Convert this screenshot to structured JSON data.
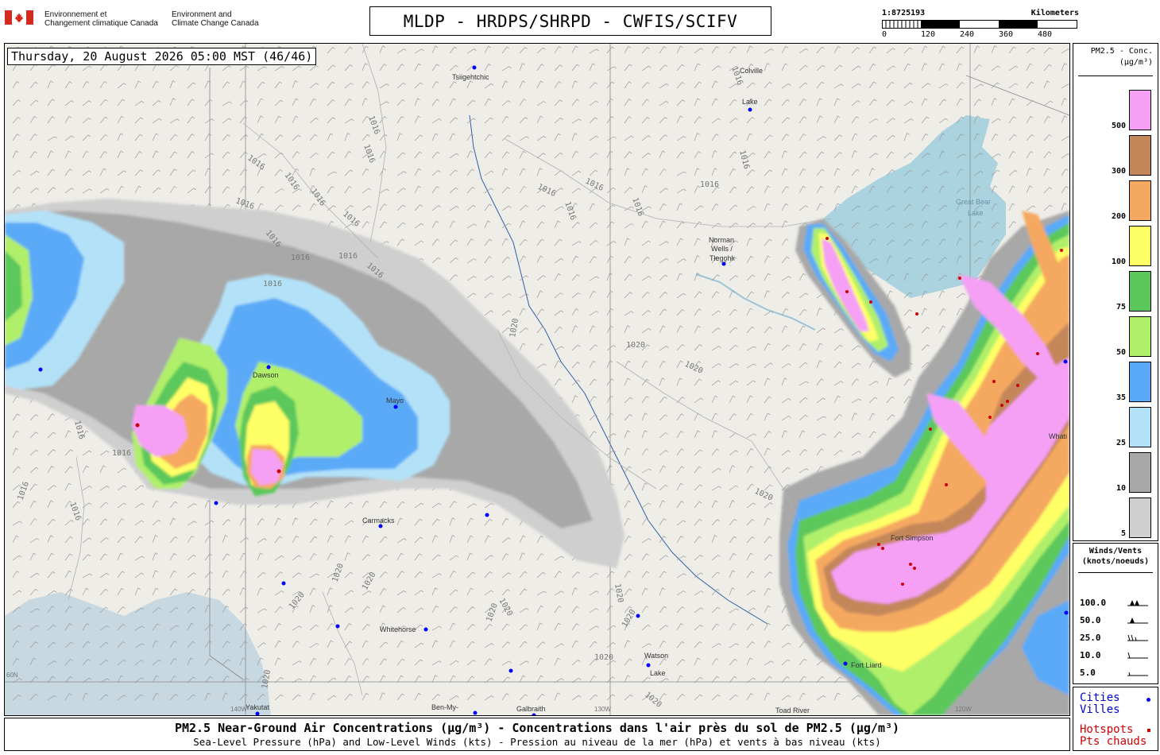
{
  "agency": {
    "name_fr": [
      "Environnement et",
      "Changement climatique Canada"
    ],
    "name_en": [
      "Environment and",
      "Climate Change Canada"
    ]
  },
  "title": "MLDP - HRDPS/SHRPD - CWFIS/SCIFV",
  "scale": {
    "ratio": "1:8725193",
    "unit": "Kilometers",
    "ticks": [
      "0",
      "120",
      "240",
      "360",
      "480"
    ]
  },
  "timestamp": "Thursday, 20 August 2026 05:00 MST (46/46)",
  "map": {
    "places": [
      {
        "name": "Tsiigehtchic"
      },
      {
        "name": "Colville"
      },
      {
        "name": "Lake"
      },
      {
        "name": "Great Bear"
      },
      {
        "name": "Lake"
      },
      {
        "name": "Norman"
      },
      {
        "name": "Wells /"
      },
      {
        "name": "Tłegǫhłı"
      },
      {
        "name": "Dawson"
      },
      {
        "name": "Carmacks"
      },
      {
        "name": "Whitehorse"
      },
      {
        "name": "Watson"
      },
      {
        "name": "Lake"
      },
      {
        "name": "Fort Simpson"
      },
      {
        "name": "Fort Liard"
      },
      {
        "name": "Yakutat"
      },
      {
        "name": "Ben-My-"
      },
      {
        "name": "Galbraith"
      },
      {
        "name": "Toad River"
      },
      {
        "name": "Whati"
      },
      {
        "name": "Mayo"
      }
    ],
    "graticule_labels": [
      "130W",
      "120W",
      "60N",
      "140W"
    ],
    "isobar_labels": [
      "1016",
      "1016",
      "1016",
      "1016",
      "1016",
      "1016",
      "1016",
      "1016",
      "1016",
      "1016",
      "1016",
      "1016",
      "1016",
      "1016",
      "1016",
      "1016",
      "1016",
      "1016",
      "1016",
      "1016",
      "1016",
      "1016",
      "1016",
      "1020",
      "1020",
      "1020",
      "1020",
      "1020",
      "1020",
      "1020",
      "1020",
      "1020",
      "1020",
      "1020",
      "1020",
      "1020",
      "1020"
    ]
  },
  "legend": {
    "title_lines": [
      "PM2.5 - Conc.",
      "(µg/m³)"
    ],
    "bins": [
      {
        "label": "500",
        "color": "#f5a0f5"
      },
      {
        "label": "300",
        "color": "#c4875a"
      },
      {
        "label": "200",
        "color": "#f5a860"
      },
      {
        "label": "100",
        "color": "#ffff66"
      },
      {
        "label": "75",
        "color": "#5cc85c"
      },
      {
        "label": "50",
        "color": "#b0ef6a"
      },
      {
        "label": "35",
        "color": "#5aaaf8"
      },
      {
        "label": "25",
        "color": "#b3e2f8"
      },
      {
        "label": "10",
        "color": "#a8a8a8"
      },
      {
        "label": "5",
        "color": "#cfcfcf"
      }
    ]
  },
  "winds_legend": {
    "title_lines": [
      "Winds/Vents",
      "(knots/noeuds)"
    ],
    "rows": [
      {
        "label": "100.0",
        "icon": "barb-pennants-icon"
      },
      {
        "label": "50.0",
        "icon": "barb-pennant-icon"
      },
      {
        "label": "25.0",
        "icon": "barb-two-half-icon"
      },
      {
        "label": "10.0",
        "icon": "barb-full-icon"
      },
      {
        "label": "5.0",
        "icon": "barb-half-icon"
      }
    ]
  },
  "markers_legend": {
    "cities": "Cities",
    "villes": "Villes",
    "hotspots": "Hotspots",
    "pts_chauds": "Pts chauds",
    "city_color": "#0000ff",
    "hotspot_color": "#cc0000"
  },
  "caption": {
    "line1": "PM2.5 Near-Ground Air Concentrations (µg/m³) - Concentrations dans l'air près du sol de PM2.5 (µg/m³)",
    "line2": "Sea-Level Pressure (hPa) and Low-Level Winds (kts) - Pression au niveau de la mer (hPa) et vents à bas niveau (kts)"
  }
}
